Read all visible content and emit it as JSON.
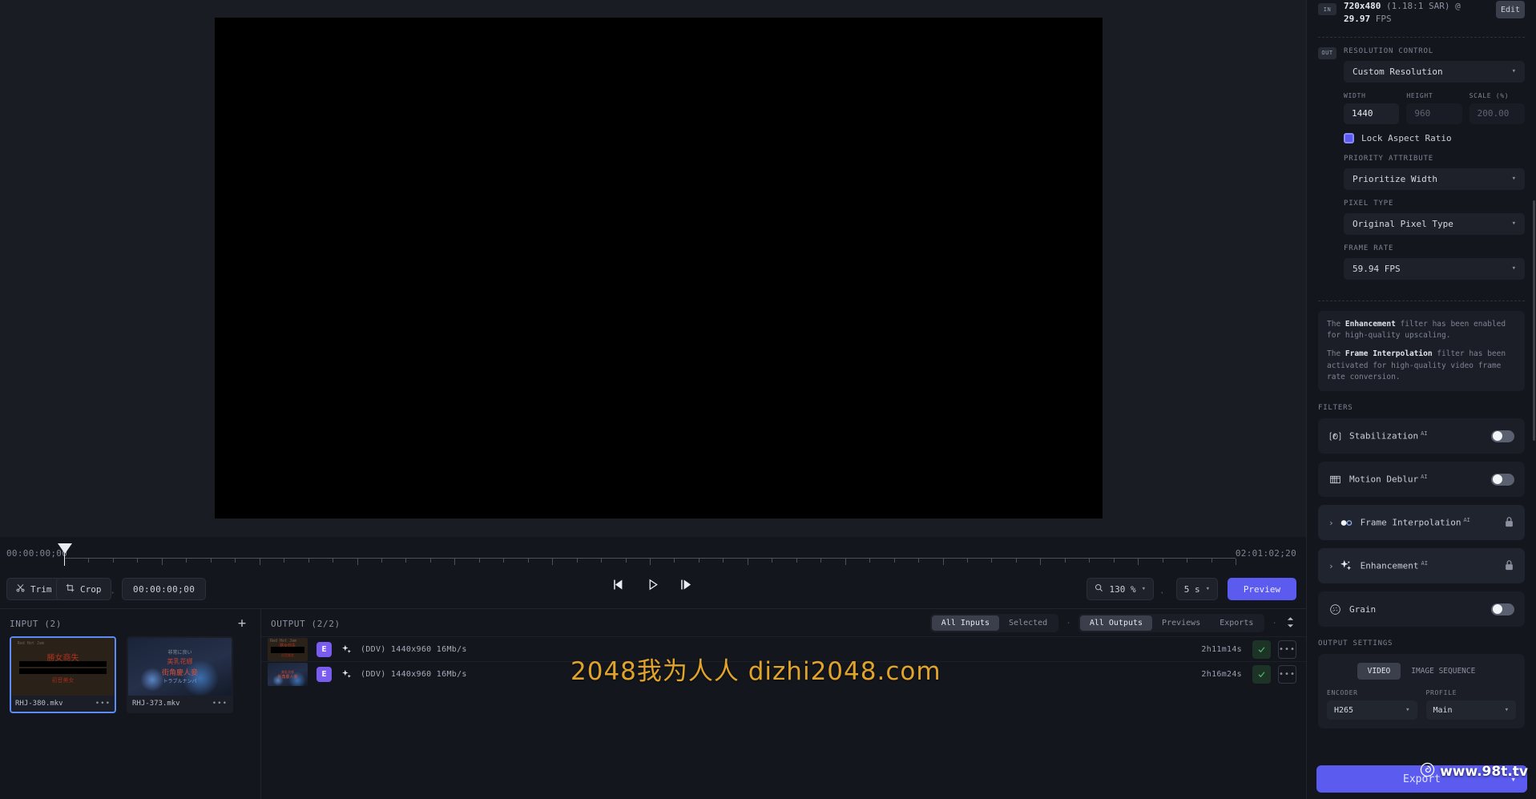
{
  "preview": {
    "timeline": {
      "start_timecode": "00:00:00;00",
      "end_timecode": "02:01:02;20",
      "playhead_timecode": "00:00:00;00"
    },
    "transport": {
      "trim_label": "Trim",
      "crop_label": "Crop",
      "current_timecode": "00:00:00;00",
      "prev_frame_icon": "step-backward-icon",
      "play_icon": "play-icon",
      "next_frame_icon": "step-forward-icon",
      "zoom_icon": "magnifier-icon",
      "zoom_value": "130 %",
      "interval_value": "5 s",
      "preview_label": "Preview"
    }
  },
  "input_pane": {
    "title": "INPUT (2)",
    "add_label": "+",
    "items": [
      {
        "filename": "RHJ-380.mkv",
        "more": "•••",
        "selected": true
      },
      {
        "filename": "RHJ-373.mkv",
        "more": "•••",
        "selected": false
      }
    ]
  },
  "output_pane": {
    "title": "OUTPUT (2/2)",
    "filters_left": [
      {
        "label": "All Inputs",
        "active": true
      },
      {
        "label": "Selected",
        "active": false
      }
    ],
    "filters_right": [
      {
        "label": "All Outputs",
        "active": true
      },
      {
        "label": "Previews",
        "active": false
      },
      {
        "label": "Exports",
        "active": false
      }
    ],
    "separator": "·",
    "sort_icon": "sort-icon",
    "rows": [
      {
        "badge": "E",
        "sparkle_icon": "sparkle-icon",
        "meta": "(DDV)  1440x960  16Mb/s",
        "duration": "2h11m14s",
        "check_icon": "check-icon",
        "more": "•••"
      },
      {
        "badge": "E",
        "sparkle_icon": "sparkle-icon",
        "meta": "(DDV)  1440x960  16Mb/s",
        "duration": "2h16m24s",
        "check_icon": "check-icon",
        "more": "•••"
      }
    ]
  },
  "watermark": {
    "center_text": "2048我为人人  dizhi2048.com",
    "brand_text": "www.98t.tv",
    "brand_icon": "rose-logo-icon",
    "color": "#e0a42a"
  },
  "sidebar": {
    "input_info": {
      "badge": "IN",
      "resolution": "720x480",
      "sar": "(1.18:1 SAR)",
      "at": "@",
      "fps": "29.97",
      "fps_unit": "FPS",
      "edit_label": "Edit"
    },
    "output_badge": "OUT",
    "resolution_control": {
      "label": "RESOLUTION CONTROL",
      "value": "Custom Resolution",
      "chevron_icon": "chevron-down-icon"
    },
    "dimensions": {
      "width_label": "WIDTH",
      "width_value": "1440",
      "height_label": "HEIGHT",
      "height_value": "960",
      "scale_label": "SCALE (%)",
      "scale_value": "200.00"
    },
    "lock_aspect": {
      "label": "Lock Aspect Ratio",
      "checked": true,
      "color": "#5b5bf0"
    },
    "priority_attribute": {
      "label": "PRIORITY ATTRIBUTE",
      "value": "Prioritize Width",
      "chevron_icon": "chevron-down-icon"
    },
    "pixel_type": {
      "label": "PIXEL TYPE",
      "value": "Original Pixel Type",
      "chevron_icon": "chevron-down-icon"
    },
    "frame_rate": {
      "label": "FRAME RATE",
      "value": "59.94 FPS",
      "chevron_icon": "chevron-down-icon"
    },
    "notices": [
      {
        "pre": "The ",
        "strong": "Enhancement",
        "post": " filter has been enabled for high-quality upscaling."
      },
      {
        "pre": "The ",
        "strong": "Frame Interpolation",
        "post": " filter has been activated for high-quality video frame rate conversion."
      }
    ],
    "filters_label": "FILTERS",
    "filters": [
      {
        "name": "Stabilization",
        "ai": "AI",
        "icon": "stabilization-icon",
        "control": "toggle",
        "on": false
      },
      {
        "name": "Motion Deblur",
        "ai": "AI",
        "icon": "motion-deblur-icon",
        "control": "toggle",
        "on": false
      },
      {
        "name": "Frame Interpolation",
        "ai": "AI",
        "icon": "frame-interpolation-icon",
        "control": "lock",
        "expandable": true
      },
      {
        "name": "Enhancement",
        "ai": "AI",
        "icon": "sparkle-icon",
        "control": "lock",
        "expandable": true
      },
      {
        "name": "Grain",
        "ai": "",
        "icon": "grain-icon",
        "control": "toggle",
        "on": false
      }
    ],
    "output_settings": {
      "label": "OUTPUT SETTINGS",
      "tabs": [
        {
          "label": "VIDEO",
          "active": true
        },
        {
          "label": "IMAGE SEQUENCE",
          "active": false
        }
      ],
      "encoder_label": "ENCODER",
      "encoder_value": "H265",
      "profile_label": "PROFILE",
      "profile_value": "Main"
    },
    "export": {
      "label": "Export",
      "chevron_icon": "chevron-down-icon",
      "color": "#5b5bf0"
    }
  }
}
